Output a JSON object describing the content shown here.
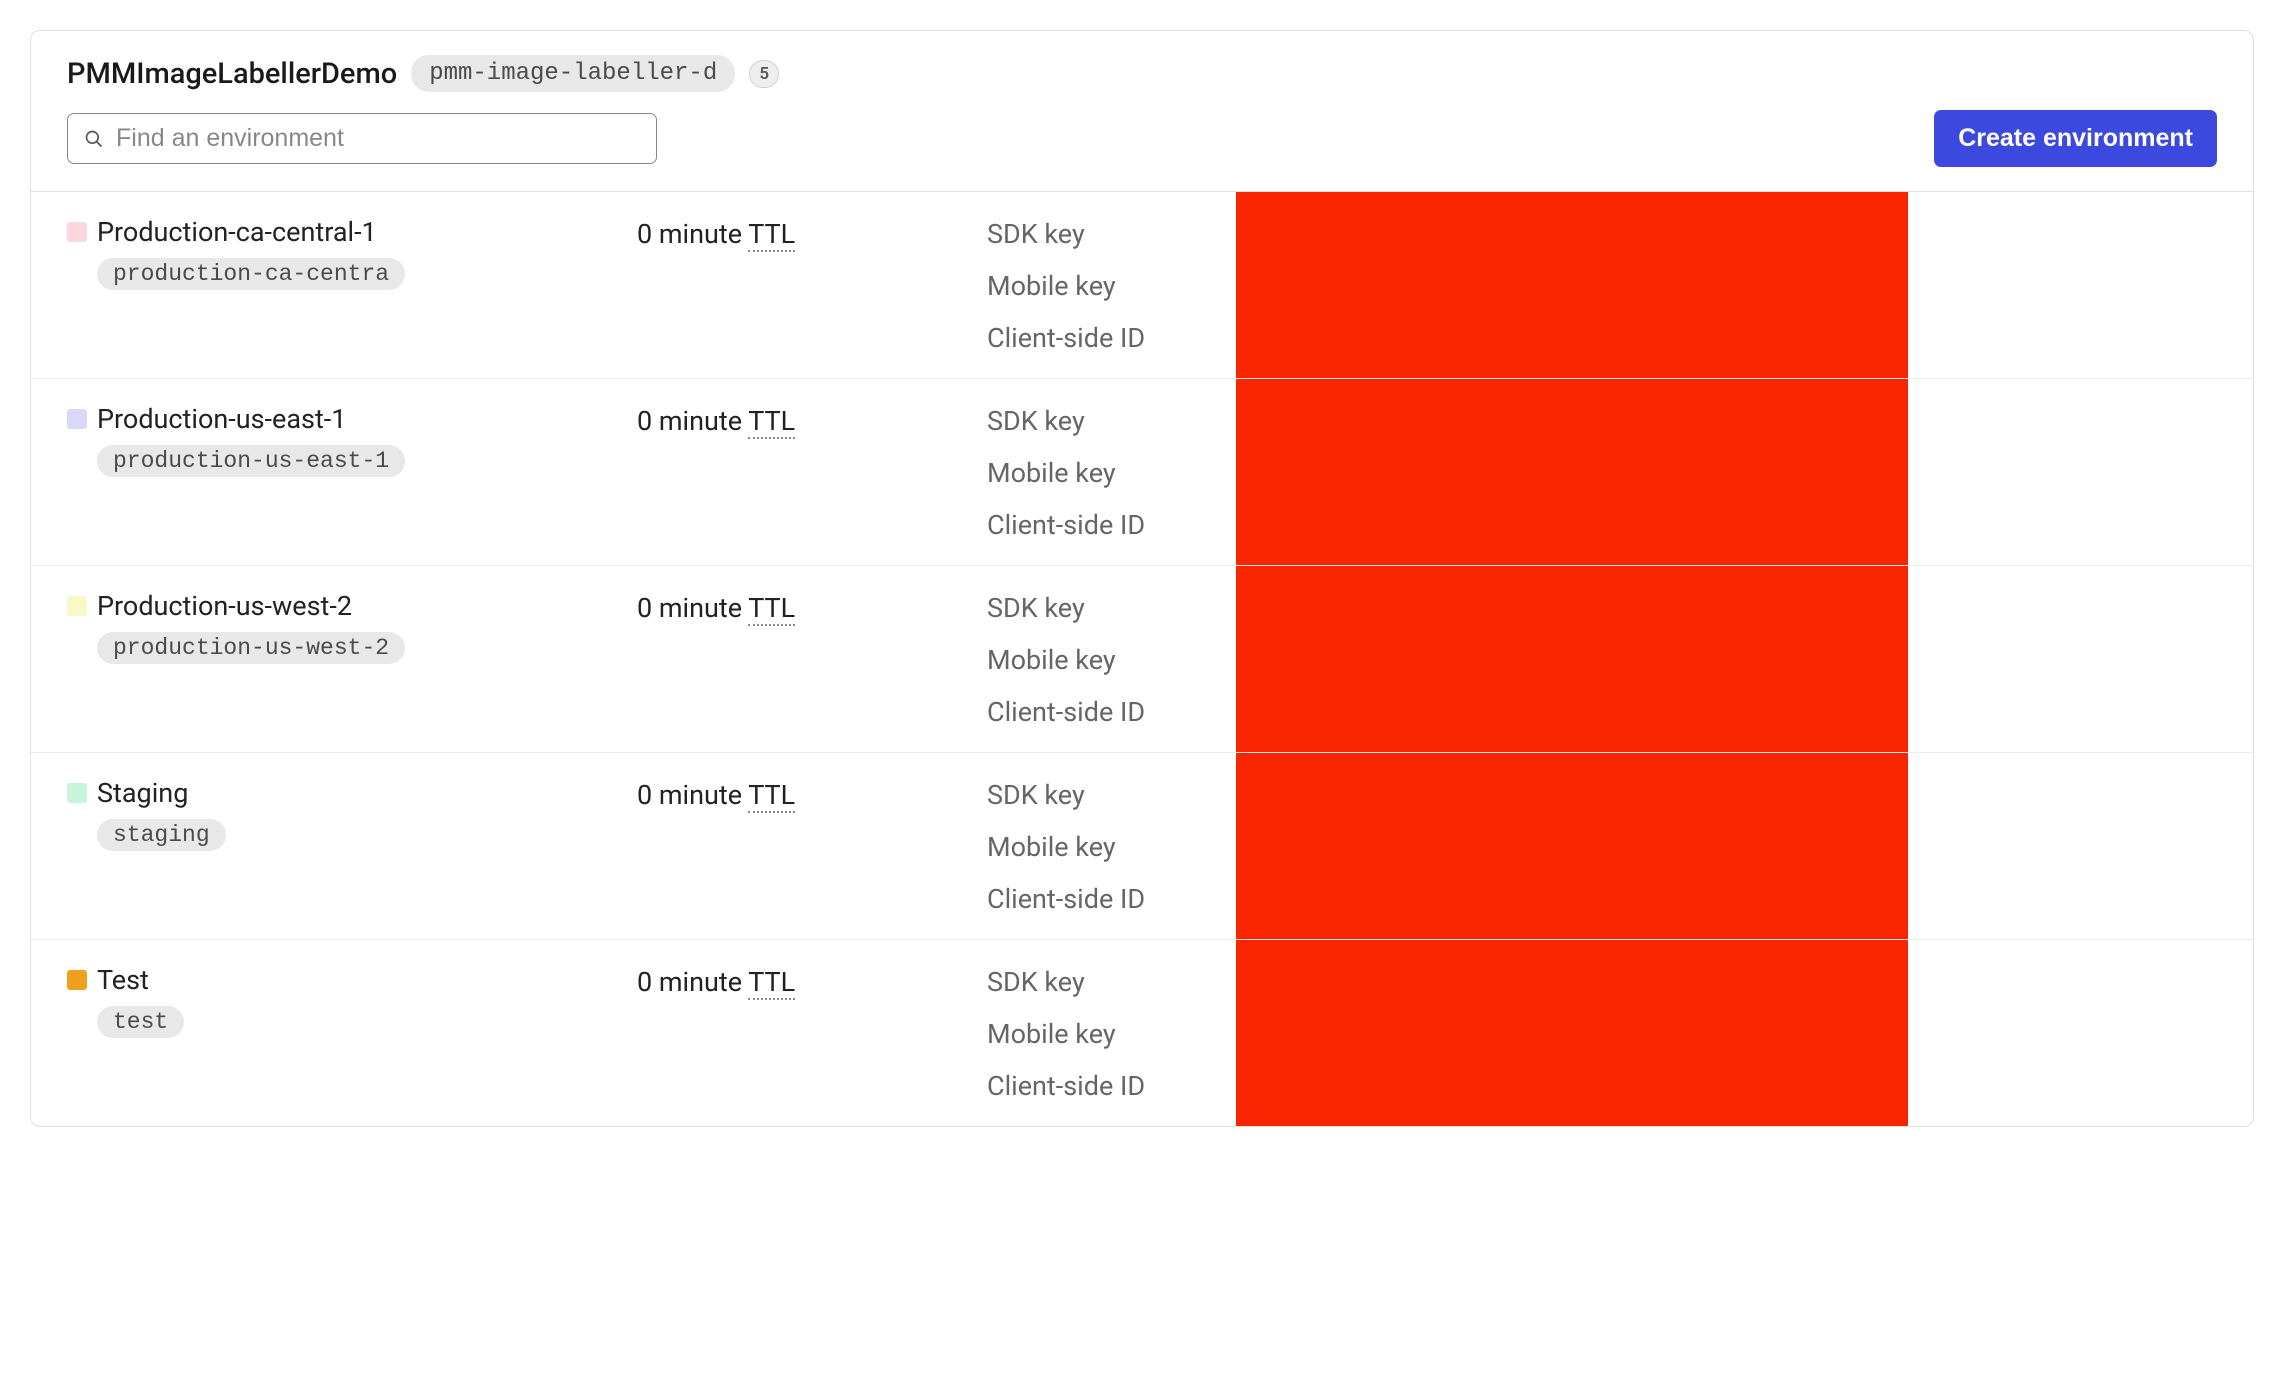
{
  "header": {
    "project_title": "PMMImageLabellerDemo",
    "project_key": "pmm-image-labeller-d",
    "env_count": "5",
    "search_placeholder": "Find an environment",
    "create_button_label": "Create environment"
  },
  "key_labels": {
    "sdk": "SDK key",
    "mobile": "Mobile key",
    "client": "Client-side ID"
  },
  "ttl_prefix": "0 minute ",
  "ttl_suffix": "TTL",
  "environments": [
    {
      "name": "Production-ca-central-1",
      "key": "production-ca-centra",
      "color": "#fcd6dd"
    },
    {
      "name": "Production-us-east-1",
      "key": "production-us-east-1",
      "color": "#d9d8f9"
    },
    {
      "name": "Production-us-west-2",
      "key": "production-us-west-2",
      "color": "#f9f8c7"
    },
    {
      "name": "Staging",
      "key": "staging",
      "color": "#c8f3dd"
    },
    {
      "name": "Test",
      "key": "test",
      "color": "#f0a01f"
    }
  ]
}
